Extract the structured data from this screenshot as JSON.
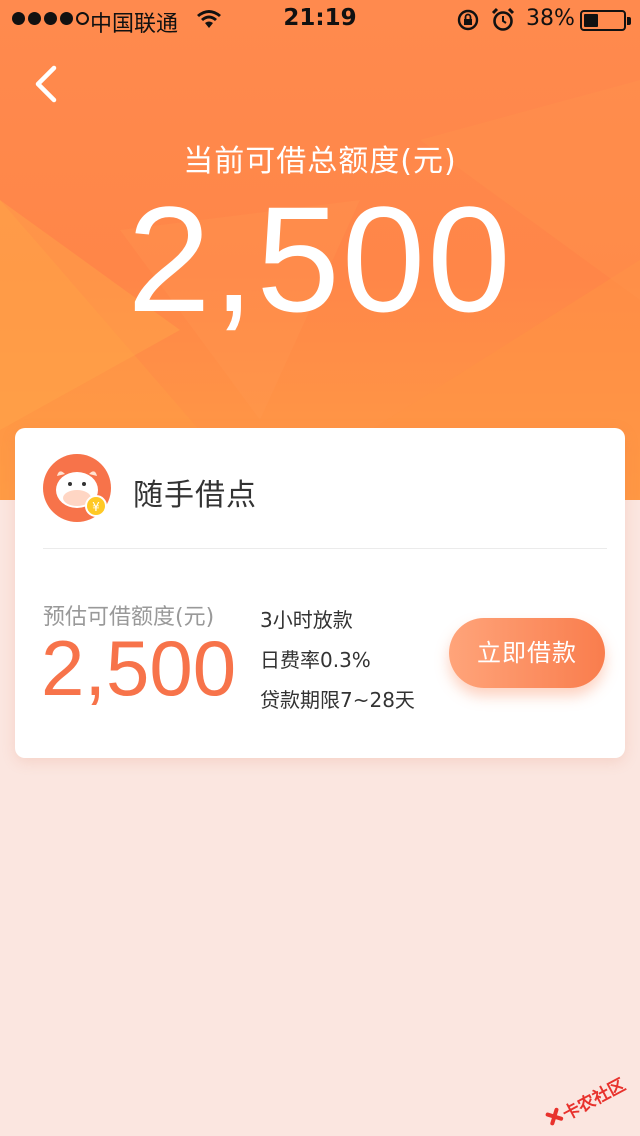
{
  "status_bar": {
    "carrier": "中国联通",
    "time": "21:19",
    "battery_percent": "38%",
    "battery_level": 0.38,
    "signal_bars": 4
  },
  "header": {
    "back_icon": "chevron-left-icon",
    "title": "当前可借总额度(元)",
    "amount": "2,500"
  },
  "card": {
    "brand_name": "随手借点",
    "avatar_icon": "cow-mascot-icon",
    "estimate_label": "预估可借额度(元)",
    "estimate_amount": "2,500",
    "info": [
      "3小时放款",
      "日费率0.3%",
      "贷款期限7~28天"
    ],
    "cta_label": "立即借款"
  },
  "watermark": "卡农社区",
  "colors": {
    "accent": "#f7734a",
    "header_orange": "#ff8a4e",
    "page_bg": "#fbe6e0"
  }
}
